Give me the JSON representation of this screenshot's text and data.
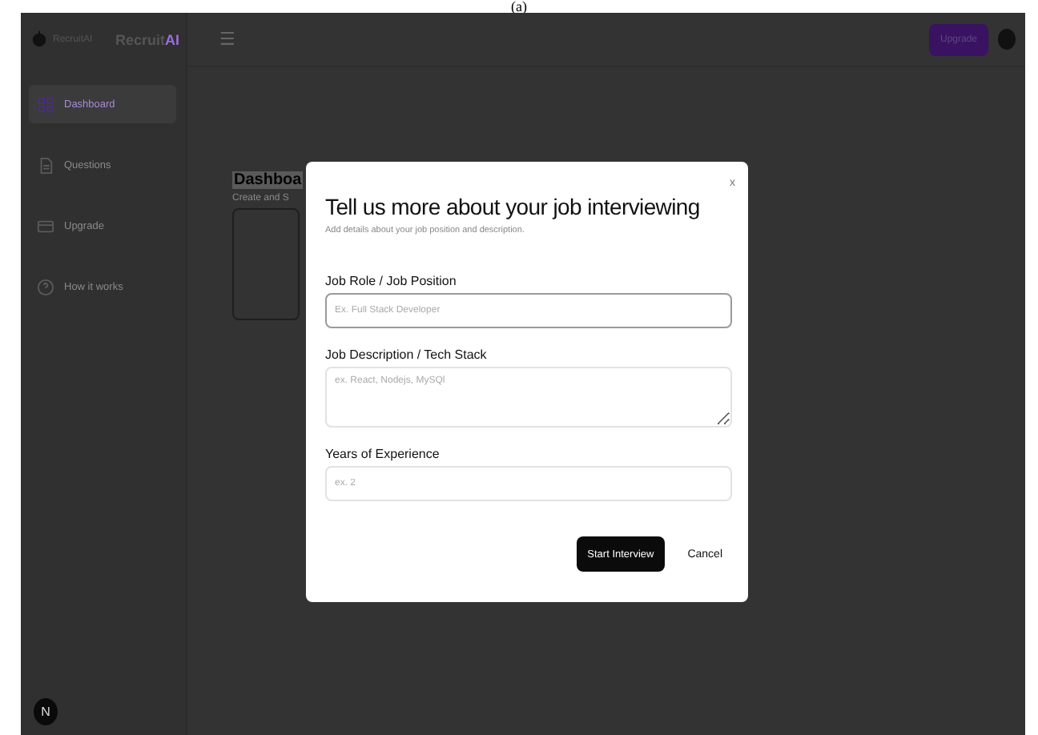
{
  "caption": "(a)",
  "sidebar": {
    "logo_text": "RecruitAI",
    "brand": {
      "main": "Recruit",
      "accent": "AI"
    },
    "items": [
      {
        "label": "Dashboard",
        "kind": "grid",
        "selected": true
      },
      {
        "label": "Questions",
        "kind": "document",
        "selected": false
      },
      {
        "label": "Upgrade",
        "kind": "card",
        "selected": false
      },
      {
        "label": "How it works",
        "kind": "help",
        "selected": false
      }
    ],
    "user_initial": "N"
  },
  "header": {
    "menu": "☰",
    "upgrade_button": "Upgrade"
  },
  "page": {
    "title": "Dashboa",
    "subtitle": "Create and S"
  },
  "modal": {
    "close": "x",
    "title": "Tell us more about your job interviewing",
    "description": "Add details about your job position and description.",
    "fields": [
      {
        "label": "Job Role / Job Position",
        "placeholder": "Ex. Full Stack Developer",
        "kind": "input",
        "focused": true
      },
      {
        "label": "Job Description / Tech Stack",
        "placeholder": "ex. React, Nodejs, MySQl",
        "kind": "textarea",
        "focused": false
      },
      {
        "label": "Years of Experience",
        "placeholder": "ex. 2",
        "kind": "input",
        "focused": false
      }
    ],
    "primary_button": "Start Interview",
    "secondary_button": "Cancel"
  }
}
